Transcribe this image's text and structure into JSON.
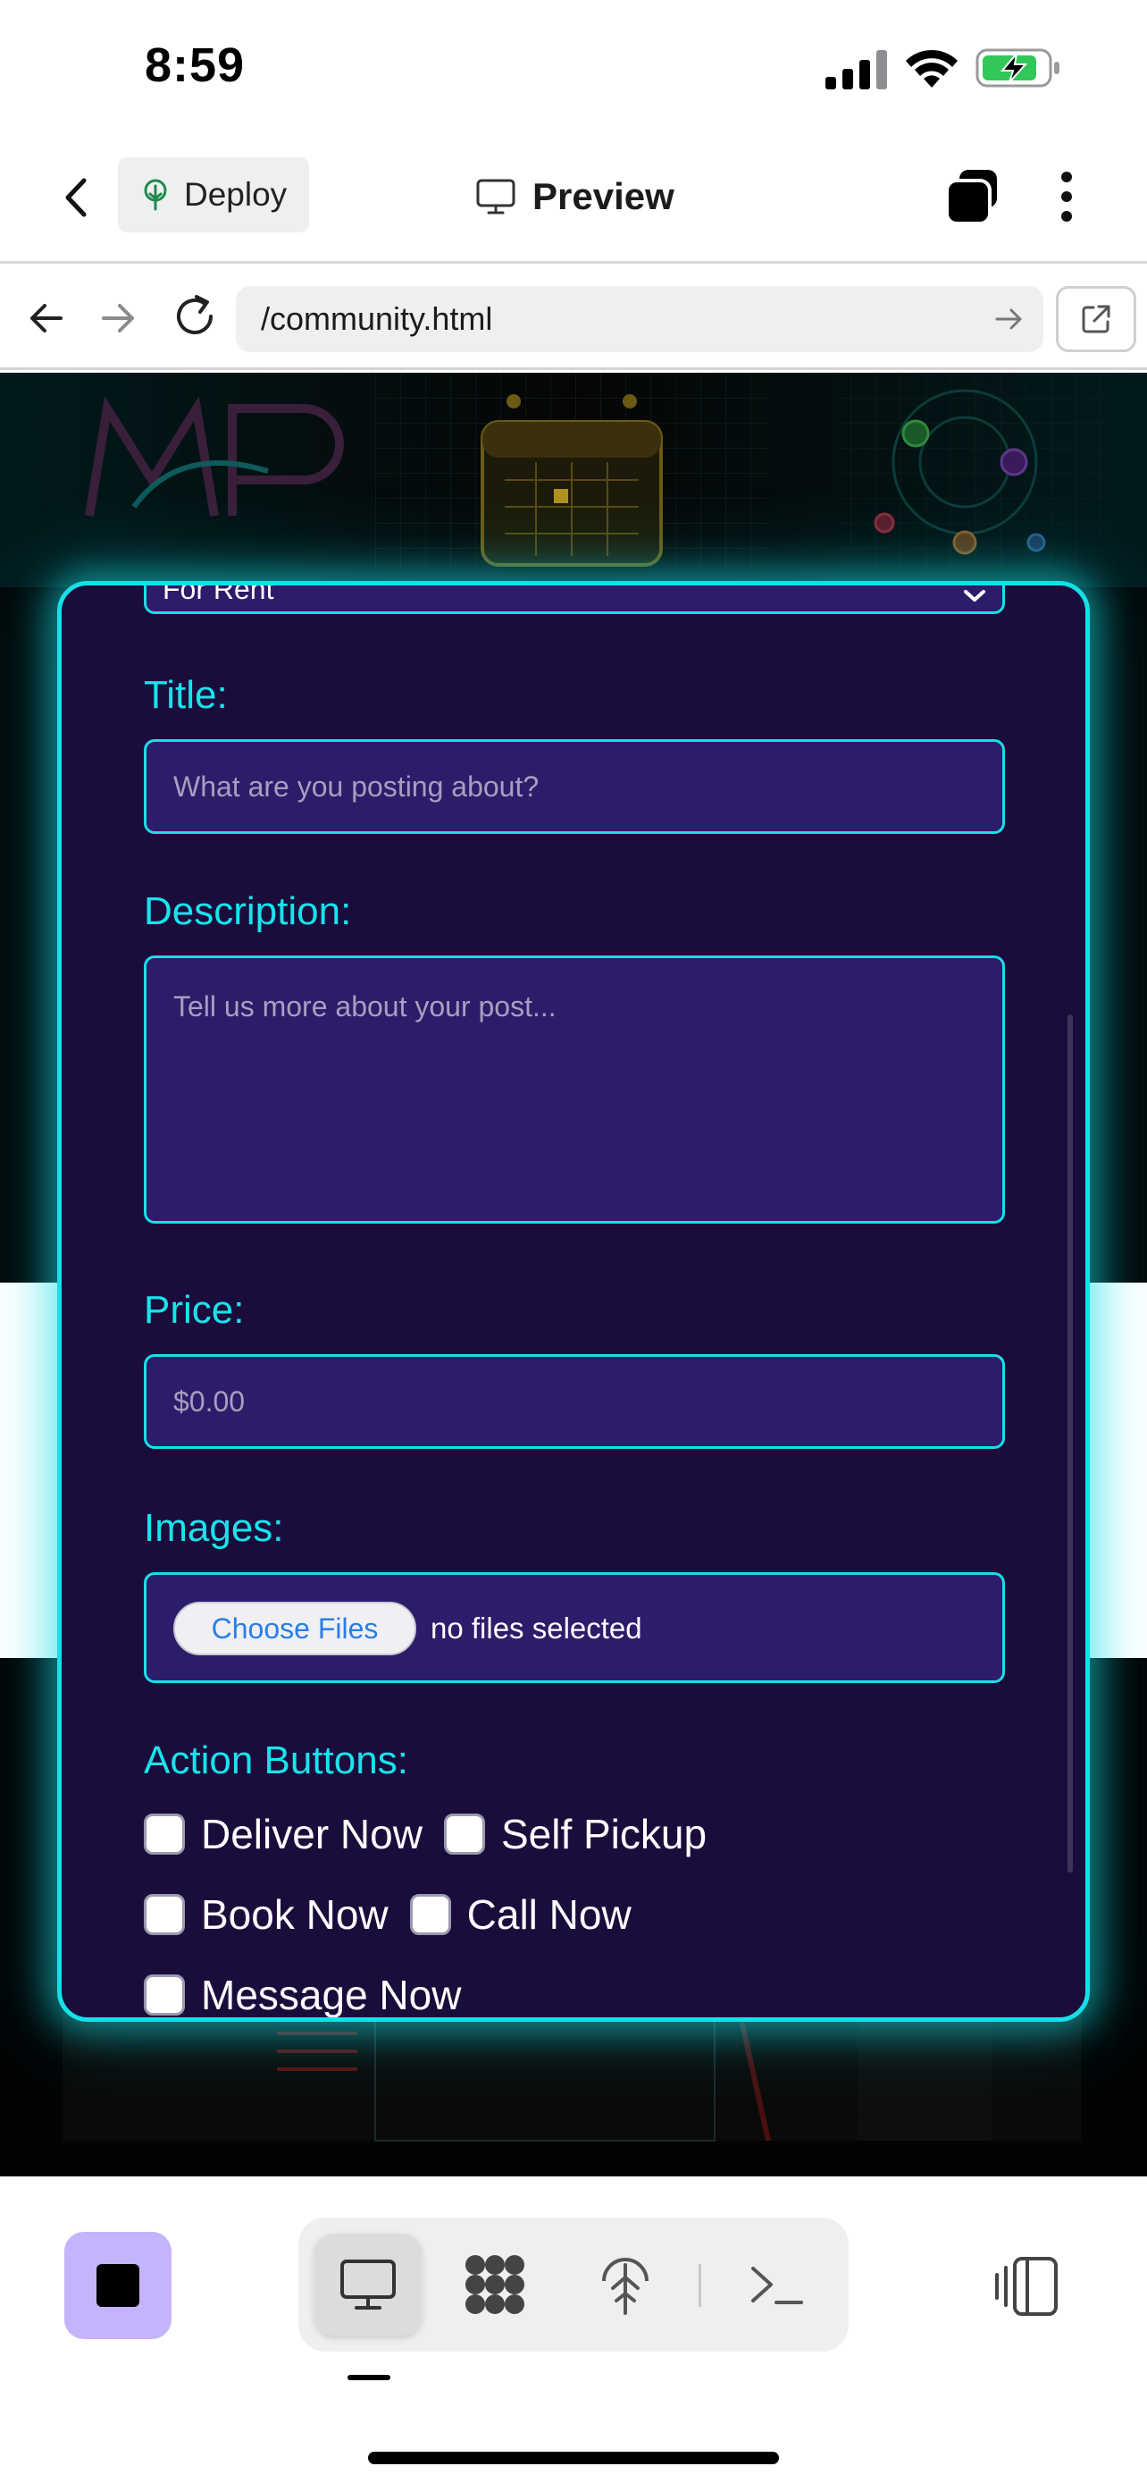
{
  "status_bar": {
    "time": "8:59"
  },
  "header": {
    "deploy_label": "Deploy",
    "preview_label": "Preview"
  },
  "browser": {
    "url": "/community.html"
  },
  "form": {
    "category_value": "For Rent",
    "title_label": "Title:",
    "title_placeholder": "What are you posting about?",
    "description_label": "Description:",
    "description_placeholder": "Tell us more about your post...",
    "price_label": "Price:",
    "price_placeholder": "$0.00",
    "images_label": "Images:",
    "choose_files_label": "Choose Files",
    "no_files_text": "no files selected",
    "action_buttons_label": "Action Buttons:",
    "actions": [
      "Deliver Now",
      "Self Pickup",
      "Book Now",
      "Call Now",
      "Message Now"
    ]
  },
  "colors": {
    "accent": "#15e0e8",
    "card_bg": "#1a0d3c",
    "field_bg": "#2d1c6a",
    "stop_button": "#c5b3fb"
  }
}
